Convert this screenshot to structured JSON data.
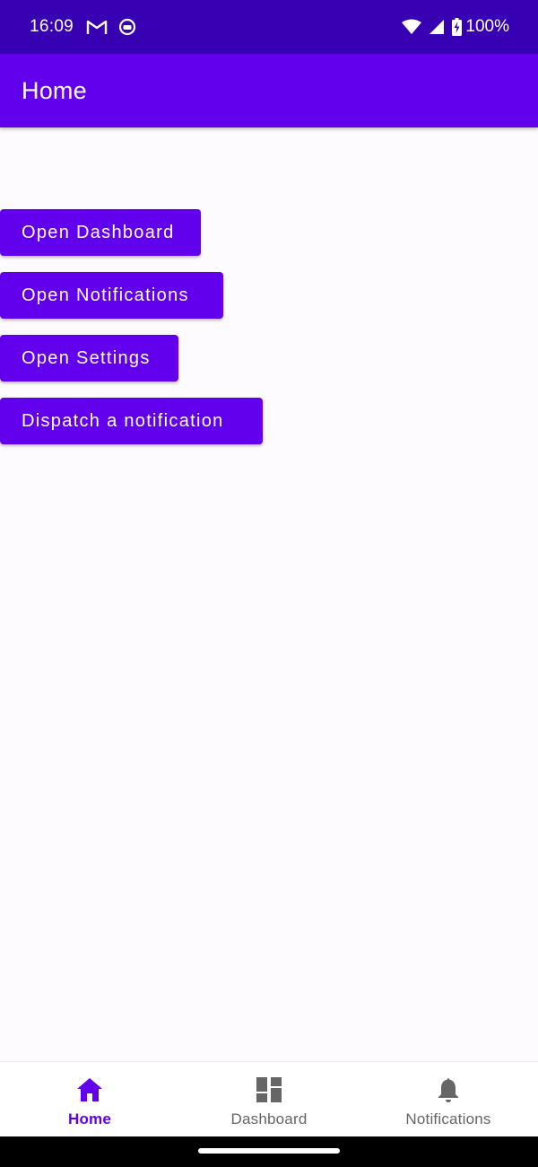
{
  "status_bar": {
    "time": "16:09",
    "left_icons": [
      "gmail-icon",
      "app-notification-icon"
    ],
    "right_icons": [
      "wifi-icon",
      "cell-signal-icon",
      "battery-charging-icon"
    ],
    "battery": "100%"
  },
  "app_bar": {
    "title": "Home"
  },
  "buttons": {
    "open_dashboard": "Open Dashboard",
    "open_notifications": "Open Notifications",
    "open_settings": "Open Settings",
    "dispatch_notification": "Dispatch a notification"
  },
  "bottom_nav": {
    "items": [
      {
        "label": "Home",
        "icon": "home-icon",
        "active": true
      },
      {
        "label": "Dashboard",
        "icon": "dashboard-icon",
        "active": false
      },
      {
        "label": "Notifications",
        "icon": "bell-icon",
        "active": false
      }
    ]
  },
  "colors": {
    "status_bar": "#3700b3",
    "primary": "#6200ee",
    "inactive_nav": "#666666",
    "background": "#fdfbfd"
  }
}
